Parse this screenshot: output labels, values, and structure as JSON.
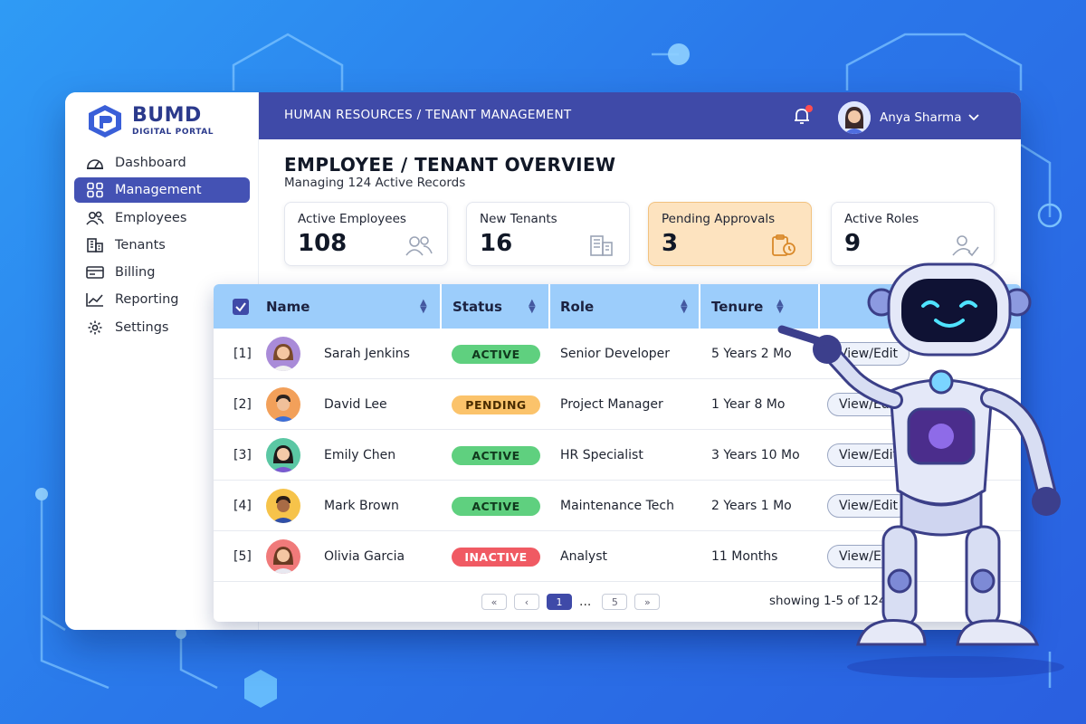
{
  "app": {
    "logo_main": "BUMD",
    "logo_sub": "DIGITAL PORTAL",
    "breadcrumb": "HUMAN RESOURCES / TENANT MANAGEMENT",
    "user_name": "Anya Sharma"
  },
  "sidebar": {
    "items": [
      {
        "label": "Dashboard",
        "icon": "dashboard-icon"
      },
      {
        "label": "Management",
        "icon": "grid-icon",
        "active": true
      },
      {
        "label": "Employees",
        "icon": "users-icon"
      },
      {
        "label": "Tenants",
        "icon": "building-icon"
      },
      {
        "label": "Billing",
        "icon": "billing-icon"
      },
      {
        "label": "Reporting",
        "icon": "chart-line-icon"
      },
      {
        "label": "Settings",
        "icon": "gear-icon"
      }
    ]
  },
  "page": {
    "title": "EMPLOYEE / TENANT OVERVIEW",
    "subtitle": "Managing 124 Active Records"
  },
  "cards": [
    {
      "label": "Active Employees",
      "value": "108",
      "icon": "users-icon"
    },
    {
      "label": "New Tenants",
      "value": "16",
      "icon": "building-icon"
    },
    {
      "label": "Pending Approvals",
      "value": "3",
      "icon": "clipboard-clock-icon"
    },
    {
      "label": "Active Roles",
      "value": "9",
      "icon": "user-check-icon"
    }
  ],
  "table": {
    "columns": [
      "Name",
      "Status",
      "Role",
      "Tenure"
    ],
    "rows": [
      {
        "index": "[1]",
        "name": "Sarah Jenkins",
        "status": "ACTIVE",
        "role": "Senior Developer",
        "tenure": "5 Years 2 Mo",
        "action": "View/Edit"
      },
      {
        "index": "[2]",
        "name": "David Lee",
        "status": "PENDING",
        "role": "Project Manager",
        "tenure": "1 Year 8 Mo",
        "action": "View/Edit"
      },
      {
        "index": "[3]",
        "name": "Emily Chen",
        "status": "ACTIVE",
        "role": "HR Specialist",
        "tenure": "3 Years 10 Mo",
        "action": "View/Edit"
      },
      {
        "index": "[4]",
        "name": "Mark Brown",
        "status": "ACTIVE",
        "role": "Maintenance Tech",
        "tenure": "2 Years 1 Mo",
        "action": "View/Edit"
      },
      {
        "index": "[5]",
        "name": "Olivia Garcia",
        "status": "INACTIVE",
        "role": "Analyst",
        "tenure": "11 Months",
        "action": "View/Edit"
      }
    ]
  },
  "pagination": {
    "first": "«",
    "prev": "‹",
    "current": "1",
    "ellipsis": "...",
    "last_page": "5",
    "next": "»",
    "showing": "showing 1-5 of 124"
  },
  "colors": {
    "primary": "#3f4aa8",
    "table_header": "#9ccdfb",
    "active": "#5fd07f",
    "pending": "#fbc36b",
    "inactive": "#f05a63",
    "highlight_card": "#fde3bf"
  }
}
